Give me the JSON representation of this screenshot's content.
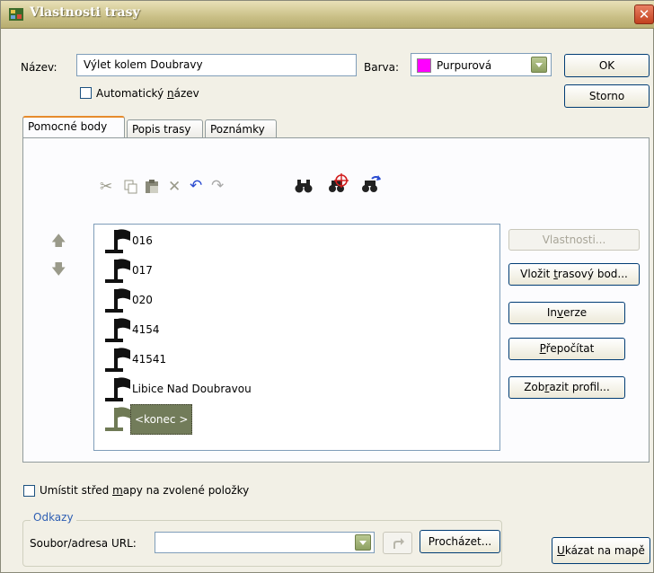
{
  "window": {
    "title": "Vlastnosti trasy",
    "close_glyph": "✕"
  },
  "header": {
    "name_label": "Název:",
    "name_value": "Výlet kolem Doubravy",
    "auto_name_label_pre": "Automatický ",
    "auto_name_label_u": "n",
    "auto_name_label_post": "ázev",
    "color_label": "Barva:",
    "color_value": "Purpurová",
    "color_swatch": "#ff00ff",
    "ok_label": "OK",
    "cancel_label": "Storno"
  },
  "tabs": [
    {
      "label": "Pomocné body",
      "active": true
    },
    {
      "label": "Popis trasy",
      "active": false
    },
    {
      "label": "Poznámky",
      "active": false
    }
  ],
  "toolbar": {
    "icons": [
      "cut-icon",
      "copy-icon",
      "paste-icon",
      "delete-icon",
      "undo-icon",
      "redo-icon",
      "find-icon",
      "find-on-map-icon",
      "find-next-icon"
    ]
  },
  "waypoints": [
    {
      "label": "016",
      "selected": false
    },
    {
      "label": "017",
      "selected": false
    },
    {
      "label": "020",
      "selected": false
    },
    {
      "label": "4154",
      "selected": false
    },
    {
      "label": "41541",
      "selected": false
    },
    {
      "label": "Libice Nad Doubravou",
      "selected": false
    },
    {
      "label": "<konec >",
      "selected": true
    }
  ],
  "side_buttons": {
    "properties": "Vlastnosti...",
    "insert_pre": "Vložit ",
    "insert_u": "t",
    "insert_post": "rasový bod...",
    "invert_pre": "In",
    "invert_u": "v",
    "invert_post": "erze",
    "recalc_pre": "",
    "recalc_u": "P",
    "recalc_post": "řepočítat",
    "profile_pre": "Zob",
    "profile_u": "r",
    "profile_post": "azit profil..."
  },
  "center_map_pre": "Umístit střed ",
  "center_map_u": "m",
  "center_map_post": "apy na zvolené položky",
  "links": {
    "group_title": "Odkazy",
    "url_label": "Soubor/adresa URL:",
    "url_value": "",
    "browse_label": "Procházet..."
  },
  "show_on_map_pre": "",
  "show_on_map_u": "U",
  "show_on_map_post": "kázat na mapě",
  "colors": {
    "accent_tab": "#e68b2c",
    "selection": "#727c5a",
    "title_bar": "#c9bf86"
  }
}
